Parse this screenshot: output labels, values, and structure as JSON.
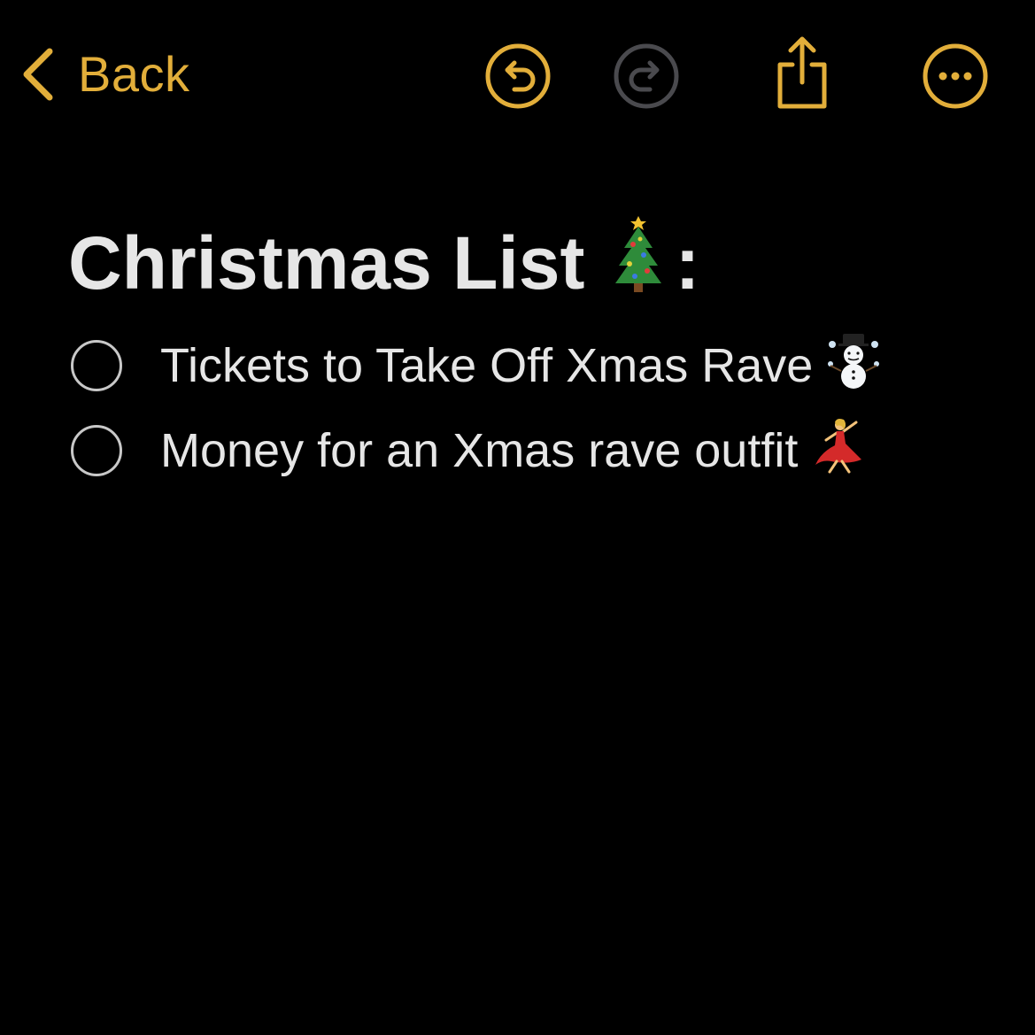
{
  "toolbar": {
    "back_label": "Back",
    "accent_color": "#E2AE3A",
    "disabled_color": "#4A4A4E",
    "icons": {
      "back": "chevron-left-icon",
      "undo": "undo-icon",
      "redo": "redo-icon",
      "share": "share-icon",
      "more": "more-icon"
    }
  },
  "note": {
    "title": "Christmas List",
    "title_suffix": ":",
    "title_emoji": "christmas-tree",
    "items": [
      {
        "text": "Tickets to Take Off Xmas Rave",
        "checked": false,
        "emoji": "snowman"
      },
      {
        "text": "Money for an Xmas rave outfit",
        "checked": false,
        "emoji": "dancer"
      }
    ]
  }
}
